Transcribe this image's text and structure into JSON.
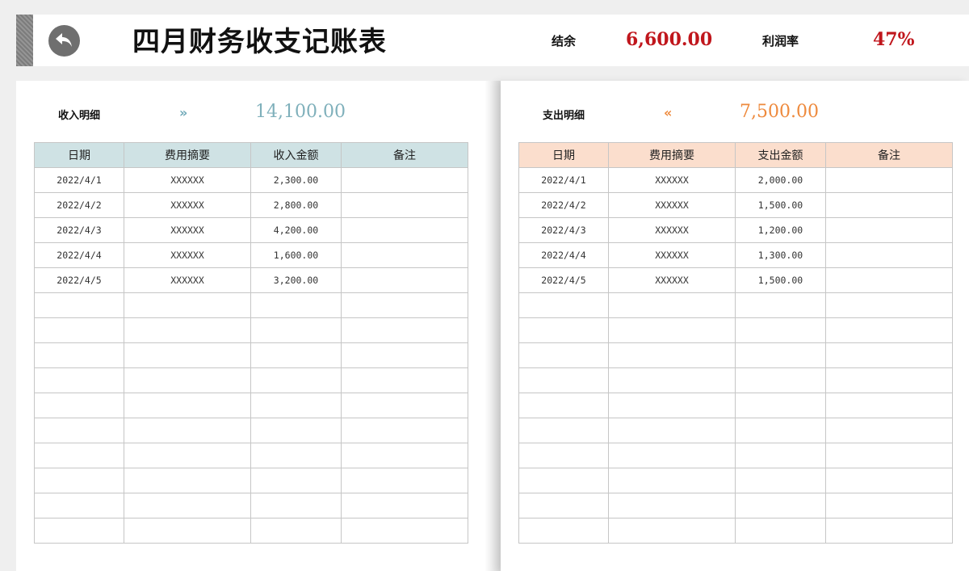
{
  "header": {
    "title": "四月财务收支记账表",
    "balance_label": "结余",
    "balance_value": "6,600.00",
    "profit_rate_label": "利润率",
    "profit_rate_value": "47%"
  },
  "income": {
    "label": "收入明细",
    "arrow": "»",
    "total": "14,100.00",
    "accent_color": "#7fb0bb",
    "header_color": "#cfe2e4",
    "columns": [
      "日期",
      "费用摘要",
      "收入金额",
      "备注"
    ],
    "rows": [
      [
        "2022/4/1",
        "XXXXXX",
        "2,300.00",
        ""
      ],
      [
        "2022/4/2",
        "XXXXXX",
        "2,800.00",
        ""
      ],
      [
        "2022/4/3",
        "XXXXXX",
        "4,200.00",
        ""
      ],
      [
        "2022/4/4",
        "XXXXXX",
        "1,600.00",
        ""
      ],
      [
        "2022/4/5",
        "XXXXXX",
        "3,200.00",
        ""
      ],
      [
        "",
        "",
        "",
        ""
      ],
      [
        "",
        "",
        "",
        ""
      ],
      [
        "",
        "",
        "",
        ""
      ],
      [
        "",
        "",
        "",
        ""
      ],
      [
        "",
        "",
        "",
        ""
      ],
      [
        "",
        "",
        "",
        ""
      ],
      [
        "",
        "",
        "",
        ""
      ],
      [
        "",
        "",
        "",
        ""
      ],
      [
        "",
        "",
        "",
        ""
      ],
      [
        "",
        "",
        "",
        ""
      ]
    ]
  },
  "expense": {
    "label": "支出明细",
    "arrow": "«",
    "total": "7,500.00",
    "accent_color": "#ee8a3d",
    "header_color": "#fbdecd",
    "columns": [
      "日期",
      "费用摘要",
      "支出金额",
      "备注"
    ],
    "rows": [
      [
        "2022/4/1",
        "XXXXXX",
        "2,000.00",
        ""
      ],
      [
        "2022/4/2",
        "XXXXXX",
        "1,500.00",
        ""
      ],
      [
        "2022/4/3",
        "XXXXXX",
        "1,200.00",
        ""
      ],
      [
        "2022/4/4",
        "XXXXXX",
        "1,300.00",
        ""
      ],
      [
        "2022/4/5",
        "XXXXXX",
        "1,500.00",
        ""
      ],
      [
        "",
        "",
        "",
        ""
      ],
      [
        "",
        "",
        "",
        ""
      ],
      [
        "",
        "",
        "",
        ""
      ],
      [
        "",
        "",
        "",
        ""
      ],
      [
        "",
        "",
        "",
        ""
      ],
      [
        "",
        "",
        "",
        ""
      ],
      [
        "",
        "",
        "",
        ""
      ],
      [
        "",
        "",
        "",
        ""
      ],
      [
        "",
        "",
        "",
        ""
      ],
      [
        "",
        "",
        "",
        ""
      ]
    ]
  },
  "icons": {
    "back": "back-arrow-icon"
  },
  "colors": {
    "highlight_red": "#c0161c"
  }
}
